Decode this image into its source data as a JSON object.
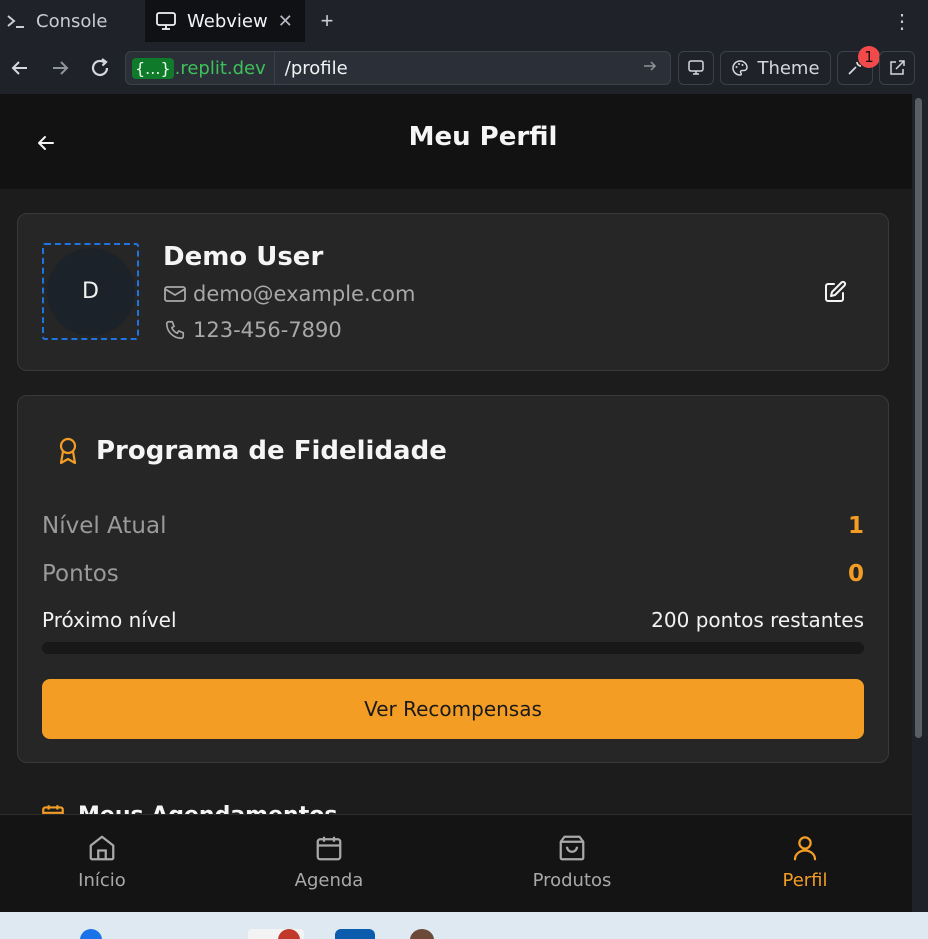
{
  "browser": {
    "tabs": [
      {
        "label": "Console",
        "icon": "terminal-icon"
      },
      {
        "label": "Webview",
        "icon": "monitor-icon"
      }
    ],
    "url": {
      "badge": "{...}",
      "host": ".replit.dev",
      "path": "/profile"
    },
    "theme_label": "Theme",
    "notification_count": "1"
  },
  "header": {
    "title": "Meu Perfil"
  },
  "profile": {
    "initial": "D",
    "name": "Demo User",
    "email": "demo@example.com",
    "phone": "123-456-7890"
  },
  "loyalty": {
    "title": "Programa de Fidelidade",
    "level_label": "Nível Atual",
    "level_value": "1",
    "points_label": "Pontos",
    "points_value": "0",
    "next_label": "Próximo nível",
    "next_value": "200 pontos restantes",
    "progress": 0,
    "button_label": "Ver Recompensas"
  },
  "next_section": {
    "title": "Meus Agendamentos"
  },
  "nav": [
    {
      "label": "Início",
      "icon": "home-icon",
      "active": false
    },
    {
      "label": "Agenda",
      "icon": "calendar-icon",
      "active": false
    },
    {
      "label": "Produtos",
      "icon": "shopping-bag-icon",
      "active": false
    },
    {
      "label": "Perfil",
      "icon": "user-icon",
      "active": true
    }
  ],
  "colors": {
    "accent": "#f39d25",
    "background": "#1c1c1c",
    "card": "#262626",
    "header": "#121212"
  }
}
